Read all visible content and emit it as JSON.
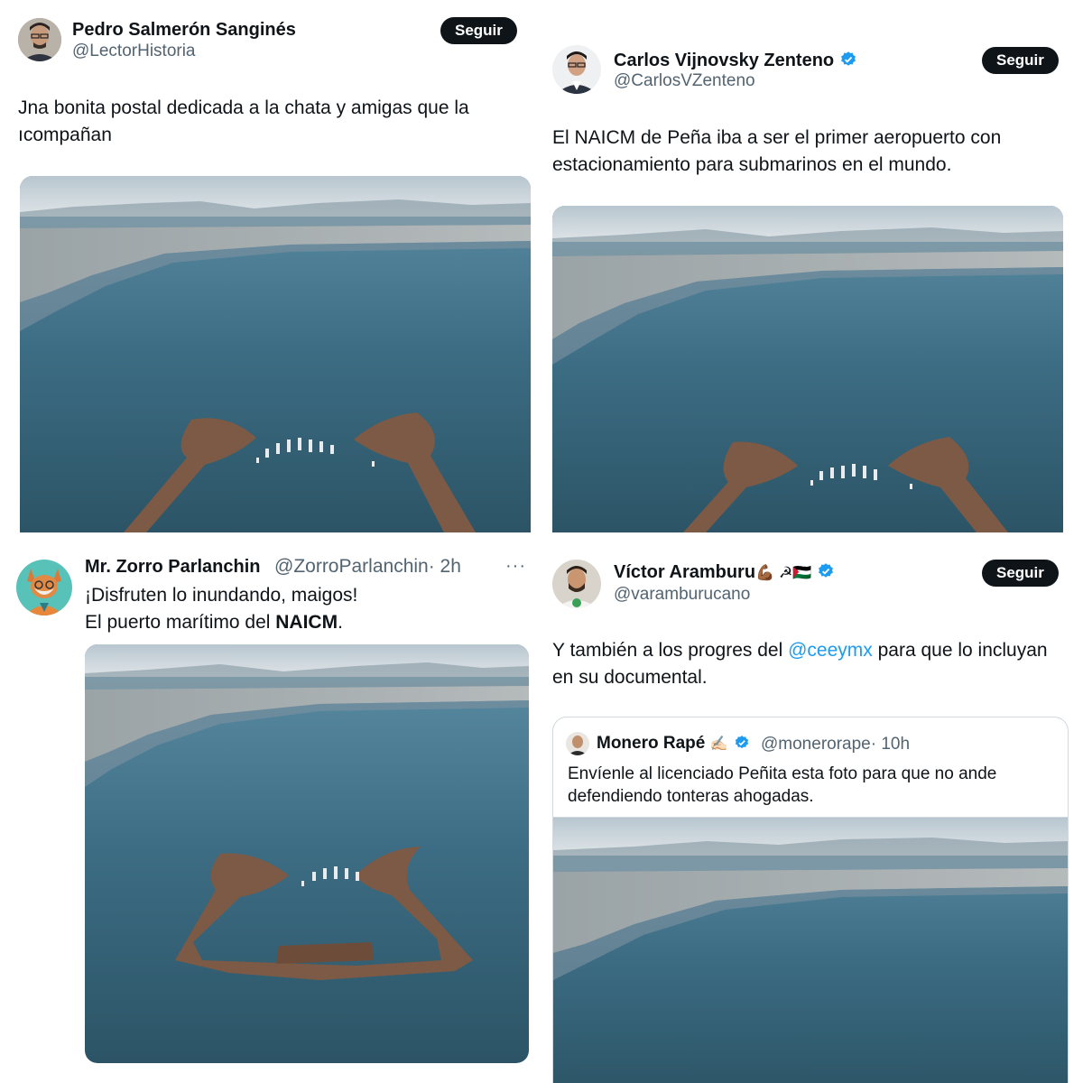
{
  "tweets": [
    {
      "name": "Pedro Salmerón Sanginés",
      "handle": "@LectorHistoria",
      "follow_label": "Seguir",
      "text_line1": "Jna bonita postal dedicada a la chata y amigas que la",
      "text_line2": "ıcompañan"
    },
    {
      "name": "Carlos Vijnovsky Zenteno",
      "handle": "@CarlosVZenteno",
      "follow_label": "Seguir",
      "text_line1": "El NAICM de Peña iba a ser el primer aeropuerto con",
      "text_line2": "estacionamiento para submarinos en el mundo."
    },
    {
      "name": "Mr. Zorro Parlanchin",
      "handle": "@ZorroParlanchin",
      "time": "· 2h",
      "more": "···",
      "text_line1": "¡Disfruten lo inundando, maigos!",
      "text_line2_prefix": "El puerto marítimo del ",
      "text_line2_bold": "NAICM",
      "text_line2_suffix": "."
    },
    {
      "name": "Víctor Aramburu",
      "name_emoji": "💪🏾 ☭🇵🇸",
      "handle": "@varamburucano",
      "follow_label": "Seguir",
      "text_line1_prefix": "Y también a los progres del ",
      "text_line1_mention": "@ceeymx",
      "text_line1_suffix": " para que lo incluyan",
      "text_line2": "en su documental.",
      "quote": {
        "name": "Monero Rapé",
        "name_emoji": "✍🏻",
        "handle": "@monerorape",
        "time": "· 10h",
        "text_line1": "Envíenle al licenciado Peñita esta foto para que no ande",
        "text_line2": "defendiendo tonteras ahogadas."
      }
    }
  ],
  "colors": {
    "accent": "#1d9bf0",
    "button_bg": "#0f1419",
    "secondary_text": "#536471",
    "water": "#3f6f86",
    "sky": "#c9d5dc"
  }
}
